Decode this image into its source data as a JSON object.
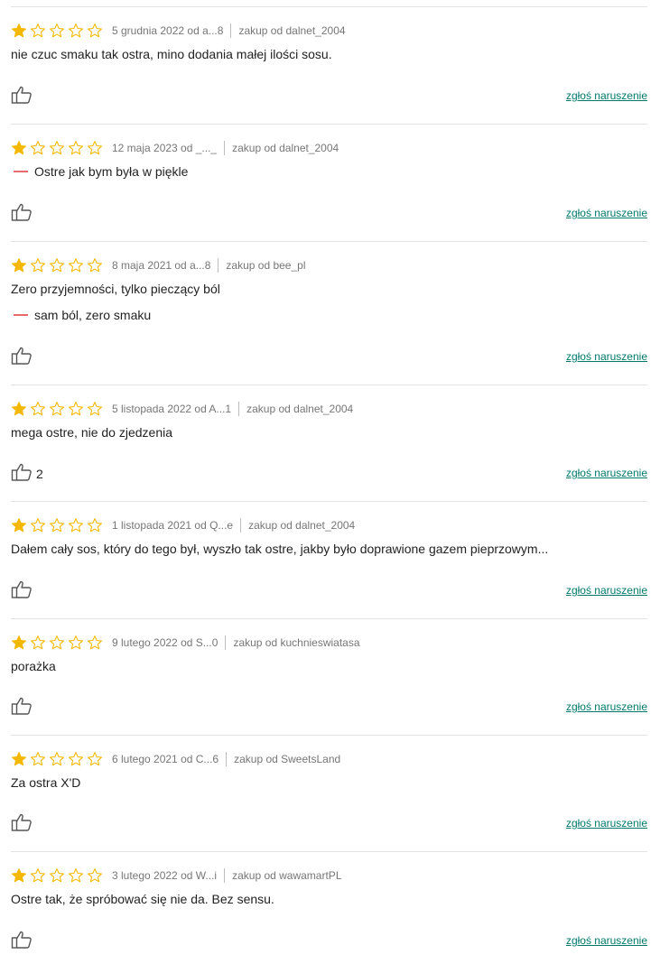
{
  "colors": {
    "star_filled": "#f5b800",
    "star_empty_outline": "#f5b800",
    "con_dash": "#e86a6a",
    "report_link": "#00796b",
    "divider": "#e3e3e3"
  },
  "icons": {
    "star": "star-icon",
    "like": "thumbs-up-icon"
  },
  "reviews": [
    {
      "rating": 1,
      "max_rating": 5,
      "date_author": "5 grudnia 2022 od a...8",
      "seller": "zakup od dalnet_2004",
      "text": "nie czuc smaku tak ostra, mino dodania małej ilości sosu.",
      "con": "",
      "likes": "",
      "report_label": "zgłoś naruszenie"
    },
    {
      "rating": 1,
      "max_rating": 5,
      "date_author": "12 maja 2023 od _..._",
      "seller": "zakup od dalnet_2004",
      "text": "",
      "con": "Ostre jak bym była w piękle",
      "likes": "",
      "report_label": "zgłoś naruszenie"
    },
    {
      "rating": 1,
      "max_rating": 5,
      "date_author": "8 maja 2021 od a...8",
      "seller": "zakup od bee_pl",
      "text": "Zero przyjemności, tylko pieczący ból",
      "con": "sam ból, zero smaku",
      "likes": "",
      "report_label": "zgłoś naruszenie"
    },
    {
      "rating": 1,
      "max_rating": 5,
      "date_author": "5 listopada 2022 od A...1",
      "seller": "zakup od dalnet_2004",
      "text": "mega ostre, nie do zjedzenia",
      "con": "",
      "likes": "2",
      "report_label": "zgłoś naruszenie"
    },
    {
      "rating": 1,
      "max_rating": 5,
      "date_author": "1 listopada 2021 od Q...e",
      "seller": "zakup od dalnet_2004",
      "text": "Dałem cały sos, który do tego był, wyszło tak ostre, jakby było doprawione gazem pieprzowym...",
      "con": "",
      "likes": "",
      "report_label": "zgłoś naruszenie"
    },
    {
      "rating": 1,
      "max_rating": 5,
      "date_author": "9 lutego 2022 od S...0",
      "seller": "zakup od kuchnieswiatasa",
      "text": "porażka",
      "con": "",
      "likes": "",
      "report_label": "zgłoś naruszenie"
    },
    {
      "rating": 1,
      "max_rating": 5,
      "date_author": "6 lutego 2021 od C...6",
      "seller": "zakup od SweetsLand",
      "text": "Za ostra X'D",
      "con": "",
      "likes": "",
      "report_label": "zgłoś naruszenie"
    },
    {
      "rating": 1,
      "max_rating": 5,
      "date_author": "3 lutego 2022 od W...i",
      "seller": "zakup od wawamartPL",
      "text": "Ostre tak, że spróbować się nie da. Bez sensu.",
      "con": "",
      "likes": "",
      "report_label": "zgłoś naruszenie"
    }
  ]
}
